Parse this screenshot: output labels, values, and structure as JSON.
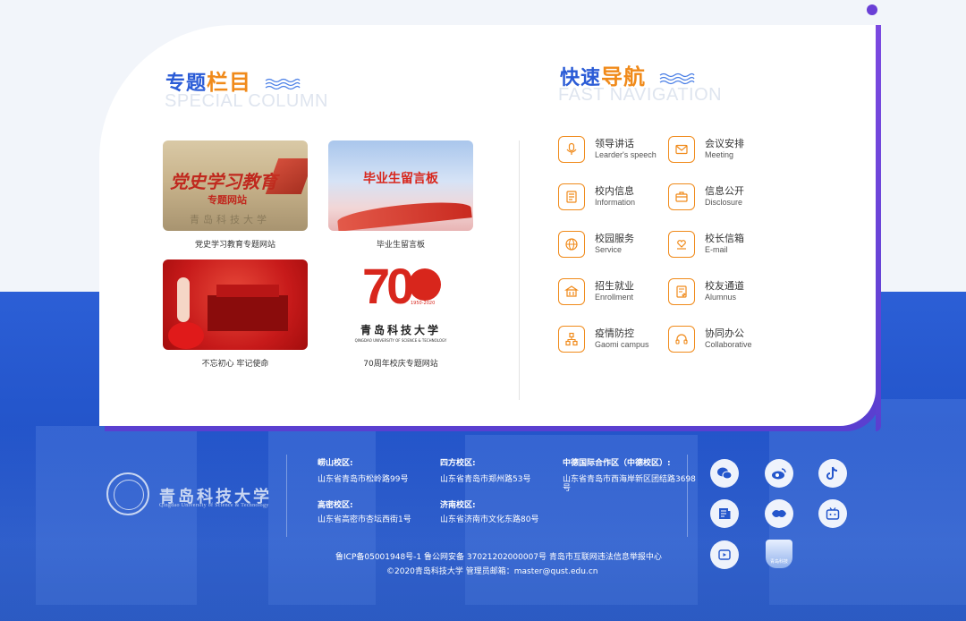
{
  "special": {
    "title_a": "专题",
    "title_b": "栏目",
    "subtitle": "SPECIAL COLUMN",
    "items": [
      {
        "caption": "党史学习教育专题网站",
        "thumb_text": "党史学习教育",
        "thumb_sub": "专题网站",
        "thumb_bottom": "青岛科技大学"
      },
      {
        "caption": "毕业生留言板",
        "thumb_text": "毕业生留言板"
      },
      {
        "caption": "不忘初心 牢记使命"
      },
      {
        "caption": "70周年校庆专题网站",
        "thumb_num": "70",
        "thumb_years": "1950-2020",
        "thumb_school": "青岛科技大学",
        "thumb_school_en": "QINGDAO UNIVERSITY OF SCIENCE & TECHNOLOGY"
      }
    ]
  },
  "nav": {
    "title_a": "快速",
    "title_b": "导航",
    "subtitle": "FAST NAVIGATION",
    "items": [
      {
        "cn": "领导讲话",
        "en": "Learder's speech",
        "icon": "microphone-icon"
      },
      {
        "cn": "会议安排",
        "en": "Meeting",
        "icon": "envelope-icon"
      },
      {
        "cn": "校内信息",
        "en": "Information",
        "icon": "document-icon"
      },
      {
        "cn": "信息公开",
        "en": "Disclosure",
        "icon": "briefcase-icon"
      },
      {
        "cn": "校园服务",
        "en": "Service",
        "icon": "globe-icon"
      },
      {
        "cn": "校长信箱",
        "en": "E-mail",
        "icon": "heart-hand-icon"
      },
      {
        "cn": "招生就业",
        "en": "Enrollment",
        "icon": "building-icon"
      },
      {
        "cn": "校友通道",
        "en": "Alumnus",
        "icon": "form-icon"
      },
      {
        "cn": "疫情防控",
        "en": "Gaomi campus",
        "icon": "network-icon"
      },
      {
        "cn": "协同办公",
        "en": "Collaborative",
        "icon": "headset-icon"
      }
    ]
  },
  "footer": {
    "logo_cn": "青岛科技大学",
    "logo_en": "Qingdao University of Science & Technology",
    "campuses": [
      {
        "label": "崂山校区:",
        "addr": "山东省青岛市松岭路99号"
      },
      {
        "label": "四方校区:",
        "addr": "山东省青岛市郑州路53号"
      },
      {
        "label": "中德国际合作区（中德校区）:",
        "addr": "山东省青岛市西海岸新区团结路3698",
        "addr2": "号"
      },
      {
        "label": "高密校区:",
        "addr": "山东省高密市杏坛西街1号"
      },
      {
        "label": "济南校区:",
        "addr": "山东省济南市文化东路80号"
      }
    ],
    "icp": "鲁ICP备05001948号-1   鲁公网安备 37021202000007号   青岛市互联网违法信息举报中心",
    "copyright": "©2020青岛科技大学   管理员邮箱：master@qust.edu.cn",
    "social": [
      "wechat-icon",
      "weibo-icon",
      "tiktok-icon",
      "news-icon",
      "xuexi-icon",
      "bilibili-icon",
      "video-icon",
      "badge-icon"
    ],
    "badge_text": "青岛科技"
  },
  "colors": {
    "primary": "#2a5bd6",
    "accent": "#f08a1a",
    "purple": "#5a3fd0"
  }
}
